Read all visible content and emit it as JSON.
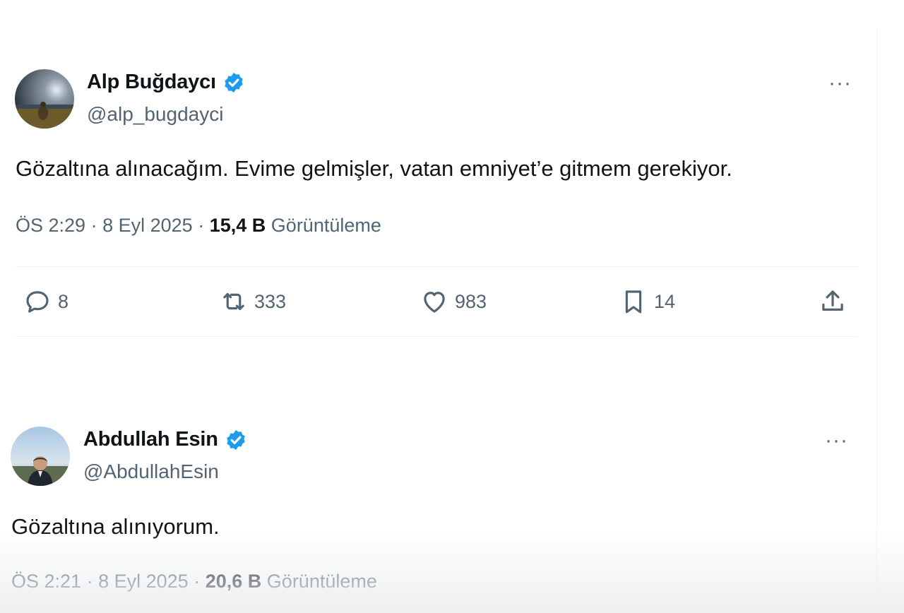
{
  "tweets": [
    {
      "display_name": "Alp Buğdaycı",
      "handle": "@alp_bugdayci",
      "verified": true,
      "text": "Gözaltına alınacağım. Evime gelmişler, vatan emniyet’e gitmem gerekiyor.",
      "time": "ÖS 2:29",
      "date": "8 Eyl 2025",
      "views_count": "15,4 B",
      "views_label": "Görüntüleme",
      "replies": "8",
      "reposts": "333",
      "likes": "983",
      "bookmarks": "14"
    },
    {
      "display_name": "Abdullah Esin",
      "handle": "@AbdullahEsin",
      "verified": true,
      "text": "Gözaltına alınıyorum.",
      "time": "ÖS 2:21",
      "date": "8 Eyl 2025",
      "views_count": "20,6 B",
      "views_label": "Görüntüleme"
    }
  ],
  "separator": "·",
  "more_label": "···",
  "colors": {
    "text_primary": "#0f1419",
    "text_secondary": "#536471",
    "verified_blue": "#1d9bf0",
    "divider": "#eff3f4"
  },
  "icons": [
    "verified-badge-icon",
    "more-icon",
    "reply-icon",
    "repost-icon",
    "like-icon",
    "bookmark-icon",
    "share-icon"
  ]
}
